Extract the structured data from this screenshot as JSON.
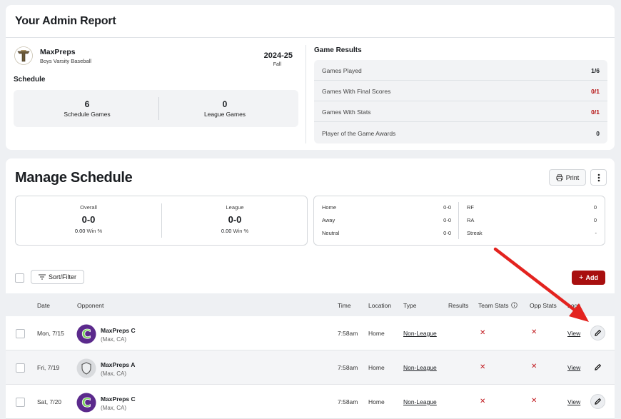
{
  "report": {
    "title": "Your Admin Report",
    "team_name": "MaxPreps",
    "team_sub": "Boys Varsity Baseball",
    "season_year": "2024-25",
    "season_term": "Fall",
    "schedule_label": "Schedule",
    "schedule_games_count": "6",
    "schedule_games_label": "Schedule Games",
    "league_games_count": "0",
    "league_games_label": "League Games",
    "game_results": {
      "title": "Game Results",
      "rows": [
        {
          "label": "Games Played",
          "value": "1/6",
          "status": "normal"
        },
        {
          "label": "Games With Final Scores",
          "value": "0/1",
          "status": "alert"
        },
        {
          "label": "Games With Stats",
          "value": "0/1",
          "status": "alert"
        },
        {
          "label": "Player of the Game Awards",
          "value": "0",
          "status": "normal"
        }
      ]
    }
  },
  "manage": {
    "title": "Manage Schedule",
    "print_label": "Print",
    "overall": {
      "label": "Overall",
      "record": "0-0",
      "pct": "0.00",
      "pct_label": "Win %"
    },
    "league": {
      "label": "League",
      "record": "0-0",
      "pct": "0.00",
      "pct_label": "Win %"
    },
    "splits": {
      "home_label": "Home",
      "home": "0-0",
      "away_label": "Away",
      "away": "0-0",
      "neutral_label": "Neutral",
      "neutral": "0-0",
      "rf_label": "RF",
      "rf": "0",
      "ra_label": "RA",
      "ra": "0",
      "streak_label": "Streak",
      "streak": "-"
    },
    "sort_label": "Sort/Filter",
    "add_label": "Add",
    "columns": {
      "date": "Date",
      "opponent": "Opponent",
      "time": "Time",
      "location": "Location",
      "type": "Type",
      "results": "Results",
      "team_stats": "Team Stats",
      "opp_stats": "Opp Stats",
      "logs": "Logs"
    },
    "games": [
      {
        "date": "Mon, 7/15",
        "opponent": "MaxPreps C",
        "opp_location": "(Max, CA)",
        "time": "7:58am",
        "location": "Home",
        "type": "Non-League",
        "logs": "View",
        "logo": "letter-c-logo"
      },
      {
        "date": "Fri, 7/19",
        "opponent": "MaxPreps A",
        "opp_location": "(Max, CA)",
        "time": "7:58am",
        "location": "Home",
        "type": "Non-League",
        "logs": "View",
        "logo": "shield-logo"
      },
      {
        "date": "Sat, 7/20",
        "opponent": "MaxPreps C",
        "opp_location": "(Max, CA)",
        "time": "7:58am",
        "location": "Home",
        "type": "Non-League",
        "logs": "View",
        "logo": "letter-c-logo"
      }
    ]
  },
  "colors": {
    "accent_red": "#a80f0f",
    "alert_red": "#b30c0c",
    "arrow_red": "#e3231f",
    "logo_purple": "#5b2a8c",
    "logo_green": "#7bd35a"
  }
}
